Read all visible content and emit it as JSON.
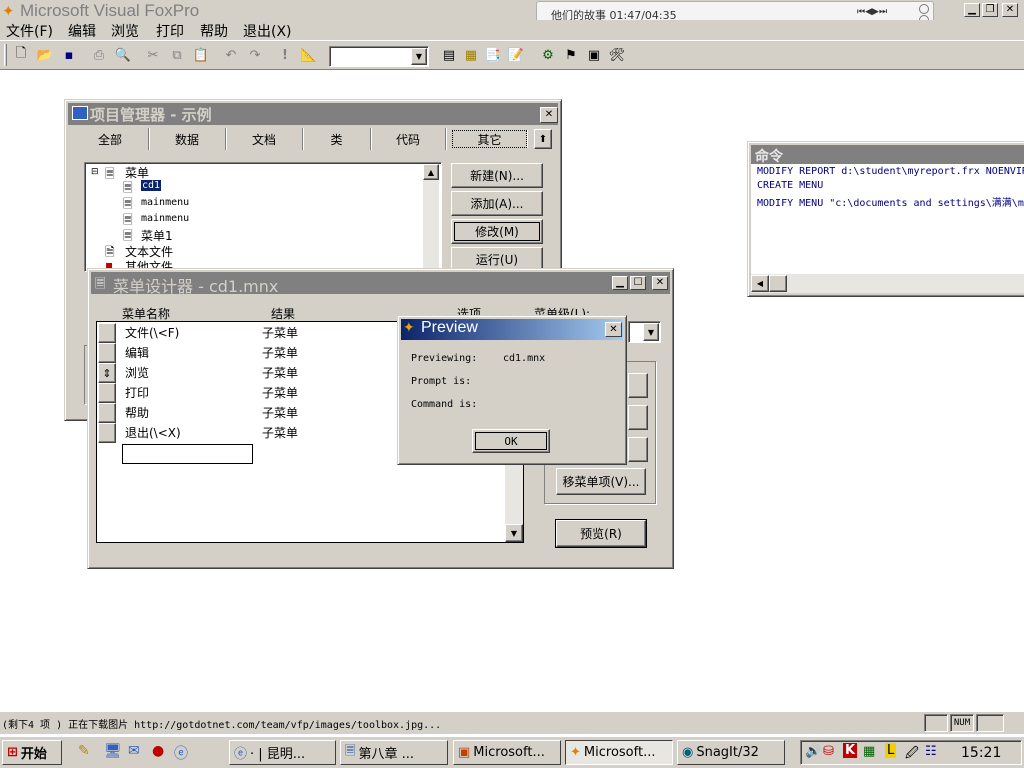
{
  "app": {
    "title": "Microsoft Visual FoxPro"
  },
  "menubar": [
    "文件(F)",
    "编辑",
    "浏览",
    "打印",
    "帮助",
    "退出(X)"
  ],
  "player": {
    "text": "他们的故事  01:47/04:35",
    "controls": "⏮◀▶⏭"
  },
  "toolbar": {
    "combo_value": ""
  },
  "project": {
    "title": "项目管理器 - 示例",
    "tabs": [
      "全部",
      "数据",
      "文档",
      "类",
      "代码",
      "其它"
    ],
    "tree": {
      "root": "菜单",
      "items": [
        "cd1",
        "mainmenu",
        "mainmenu",
        "菜单1"
      ],
      "text_files": "文本文件",
      "other_files": "其他文件"
    },
    "buttons": [
      "新建(N)...",
      "添加(A)...",
      "修改(M)",
      "运行(U)"
    ]
  },
  "menu_designer": {
    "title": "菜单设计器 - cd1.mnx",
    "col_name": "菜单名称",
    "col_result": "结果",
    "col_options": "选项",
    "col_level": "菜单级(L):",
    "rows": [
      {
        "name": "文件(\\<F)",
        "result": "子菜单"
      },
      {
        "name": "编辑",
        "result": "子菜单"
      },
      {
        "name": "浏览",
        "result": "子菜单"
      },
      {
        "name": "打印",
        "result": "子菜单"
      },
      {
        "name": "帮助",
        "result": "子菜单"
      },
      {
        "name": "退出(\\<X)",
        "result": "子菜单"
      }
    ],
    "remove_button": "移菜单项(V)...",
    "preview_button": "预览(R)"
  },
  "preview": {
    "title": "Preview",
    "previewing_label": "Previewing:",
    "previewing_value": "cd1.mnx",
    "prompt_label": "Prompt is:",
    "command_label": "Command is:",
    "ok": "OK"
  },
  "command": {
    "title": "命令",
    "lines": [
      "MODIFY REPORT d:\\student\\myreport.frx NOENVIR",
      "CREATE MENU",
      "MODIFY MENU \"c:\\documents and settings\\满满\\m"
    ]
  },
  "statusbar": {
    "text": "(剩下4 项 ) 正在下载图片 http://gotdotnet.com/team/vfp/images/toolbox.jpg...",
    "num": "NUM"
  },
  "taskbar": {
    "start": "开始",
    "tasks": [
      "· | 昆明...",
      "第八章 ...",
      "Microsoft...",
      "Microsoft...",
      "SnagIt/32"
    ],
    "time": "15:21"
  },
  "colors": {
    "active_title": "#0a246a",
    "inactive_title": "#808080",
    "face": "#d4d0c8",
    "command_text": "#000080"
  }
}
